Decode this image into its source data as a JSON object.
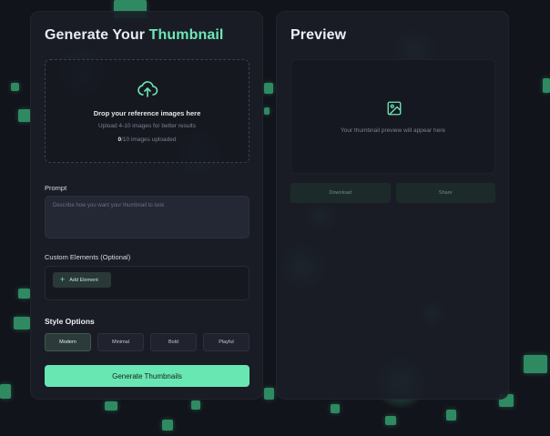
{
  "generator": {
    "title_main": "Generate Your ",
    "title_accent": "Thumbnail",
    "dropzone": {
      "icon": "cloud-upload-icon",
      "title": "Drop your reference images here",
      "subtitle": "Upload 4-10 images for better results",
      "count_uploaded": "0",
      "count_suffix": "/10 images uploaded"
    },
    "prompt": {
      "label": "Prompt",
      "placeholder": "Describe how you want your thumbnail to look"
    },
    "custom_elements": {
      "label": "Custom Elements (Optional)",
      "add_button": "Add Element"
    },
    "style_options": {
      "label": "Style Options",
      "options": [
        "Modern",
        "Minimal",
        "Bold",
        "Playful"
      ],
      "selected": "Modern"
    },
    "generate_button": "Generate Thumbnails"
  },
  "preview": {
    "title": "Preview",
    "icon": "image-icon",
    "placeholder": "Your thumbnail preview will appear here",
    "download_button": "Download",
    "share_button": "Share"
  },
  "colors": {
    "accent": "#6ee7b7",
    "background": "#12141b",
    "panel": "#1a1d26"
  }
}
